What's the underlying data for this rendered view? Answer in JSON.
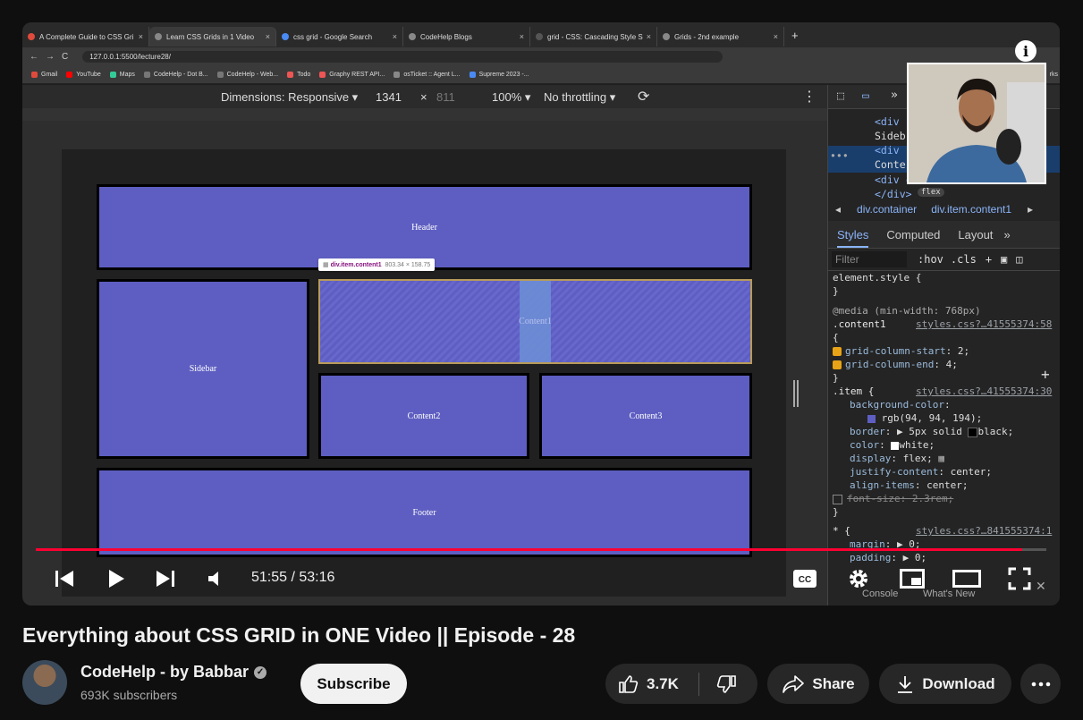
{
  "browser": {
    "tabs": [
      {
        "title": "A Complete Guide to CSS Gri",
        "active": false
      },
      {
        "title": "Learn CSS Grids in 1 Video",
        "active": true
      },
      {
        "title": "css grid - Google Search",
        "active": false
      },
      {
        "title": "CodeHelp Blogs",
        "active": false
      },
      {
        "title": "grid - CSS: Cascading Style S",
        "active": false
      },
      {
        "title": "Grids - 2nd example",
        "active": false
      }
    ],
    "url": "127.0.0.1:5500/lecture28/",
    "bookmarks": [
      "Gmail",
      "YouTube",
      "Maps",
      "CodeHelp - Dot B...",
      "CodeHelp - Web...",
      "Todo",
      "Graphy REST API...",
      "osTicket :: Agent L...",
      "Supreme 2023 -..."
    ],
    "bookmarks_tail": "rks"
  },
  "devbar": {
    "dimensions": "Dimensions: Responsive ▾",
    "width": "1341",
    "times": "×",
    "height": "811",
    "zoom": "100% ▾",
    "throttle": "No throttling ▾"
  },
  "grid": {
    "header": "Header",
    "sidebar": "Sidebar",
    "content1": "Content1",
    "content2": "Content2",
    "content3": "Content3",
    "footer": "Footer",
    "tooltip_name": "div.item.content1",
    "tooltip_size": "803.34 × 158.75"
  },
  "devtools": {
    "elements": [
      "<div",
      "Sideb",
      "<div",
      "Conte",
      "<div class=\"item\">Content2",
      "</div>"
    ],
    "flex_badge": "flex",
    "crumbs": [
      "div.container",
      "div.item.content1"
    ],
    "tabs": [
      "Styles",
      "Computed",
      "Layout",
      "»"
    ],
    "filter_placeholder": "Filter",
    "hov": ":hov",
    "cls": ".cls",
    "rules": {
      "element_style": "element.style {",
      "close": "}",
      "media": "@media (min-width: 768px)",
      "content1_selector": ".content1",
      "content1_src": "styles.css?…41555374:58",
      "open_brace": "{",
      "gcs": "grid-column-start",
      "gcs_val": "2;",
      "gce": "grid-column-end",
      "gce_val": "4;",
      "item_selector": ".item {",
      "item_src": "styles.css?…41555374:30",
      "bg": "background-color",
      "bg_val": "rgb(94, 94, 194);",
      "border": "border",
      "border_val": "▶ 5px solid",
      "border_color": "black;",
      "color": "color",
      "color_val": "white;",
      "display": "display",
      "display_val": "flex;",
      "jc": "justify-content",
      "jc_val": "center;",
      "ai": "align-items",
      "ai_val": "center;",
      "fs": "font-size",
      "fs_val": "2.3rem;",
      "star_selector": "* {",
      "star_src": "styles.css?…841555374:1",
      "margin": "margin",
      "margin_val": "▶ 0;",
      "padding": "padding",
      "padding_val": "▶ 0;"
    },
    "bottom_tabs": [
      "Console",
      "What's New"
    ]
  },
  "player": {
    "current_time": "51:55",
    "duration": "53:16",
    "time_label": "51:55 / 53:16",
    "progress": 0.976
  },
  "video": {
    "title": "Everything about CSS GRID in ONE Video || Episode - 28",
    "channel": "CodeHelp - by Babbar",
    "subscribers": "693K subscribers",
    "subscribe_label": "Subscribe",
    "likes": "3.7K",
    "share_label": "Share",
    "download_label": "Download"
  },
  "colors": {
    "grid_item": "#5e5ec2",
    "progress": "#ff0033",
    "link": "#8ab4f8"
  }
}
